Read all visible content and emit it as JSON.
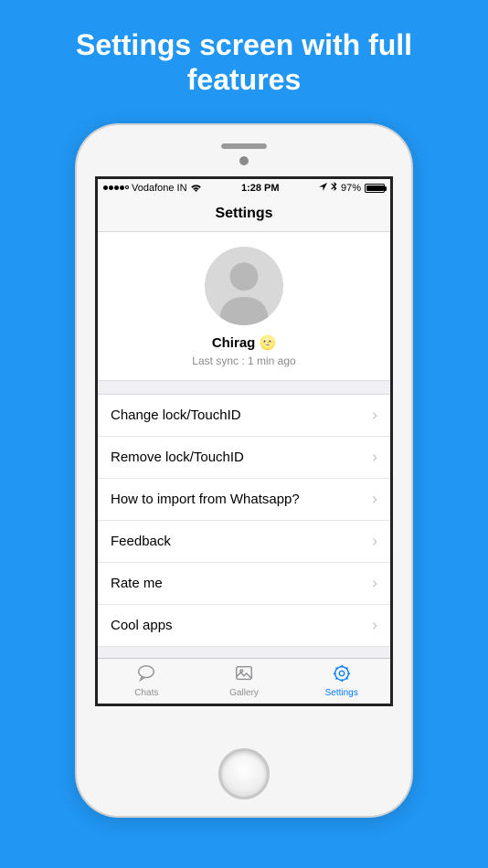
{
  "promo": {
    "line1": "Settings screen with full",
    "line2": "features"
  },
  "status_bar": {
    "carrier": "Vodafone IN",
    "time": "1:28 PM",
    "battery_percent": "97%"
  },
  "nav": {
    "title": "Settings"
  },
  "profile": {
    "name": "Chirag 🌝",
    "last_sync": "Last sync : 1 min ago"
  },
  "settings_items": [
    {
      "label": "Change lock/TouchID"
    },
    {
      "label": "Remove lock/TouchID"
    },
    {
      "label": "How to import from Whatsapp?"
    },
    {
      "label": "Feedback"
    },
    {
      "label": "Rate me"
    },
    {
      "label": "Cool apps"
    }
  ],
  "tabs": {
    "chats": "Chats",
    "gallery": "Gallery",
    "settings": "Settings"
  }
}
